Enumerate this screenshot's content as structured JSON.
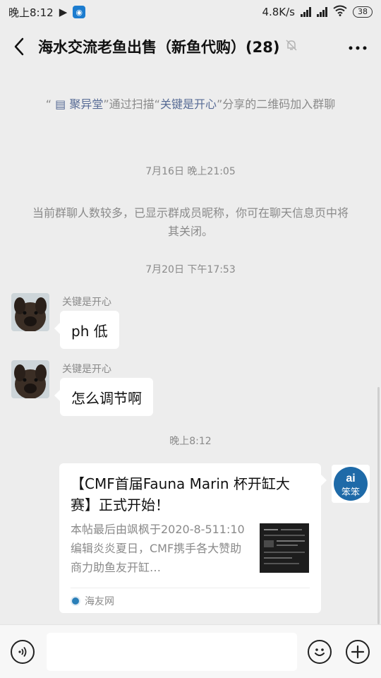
{
  "status_bar": {
    "time": "晚上8:12",
    "network_speed": "4.8K/s",
    "battery": "38"
  },
  "header": {
    "title": "海水交流老鱼出售（新鱼代购）(28)"
  },
  "system_notes": {
    "join": {
      "p1": "“ ",
      "member": "聚异堂",
      "p2": "”通过扫描“",
      "inviter": "关键是开心",
      "p3": "”分享的二维码加入群聊"
    },
    "nickname_note": "当前群聊人数较多，已显示群成员昵称，你可在聊天信息页中将其关闭。"
  },
  "timestamps": [
    "7月16日 晚上21:05",
    "7月20日 下午17:53",
    "晚上8:12"
  ],
  "messages": [
    {
      "sender": "关键是开心",
      "text": "ph 低"
    },
    {
      "sender": "关键是开心",
      "text": "怎么调节啊"
    }
  ],
  "link_card": {
    "title": "【CMF首届Fauna Marin 杯开缸大赛】正式开始！",
    "body": "本帖最后由飒枫于2020-8-511:10编辑炎炎夏日，CMF携手各大赞助商力助鱼友开缸…",
    "source": "海友网"
  },
  "colors": {
    "link_blue": "#576b95",
    "background": "#ededed",
    "bubble_white": "#ffffff",
    "muted_text": "#8a8a8a"
  },
  "icons": [
    "back-arrow-icon",
    "mute-bell-icon",
    "more-icon",
    "voice-icon",
    "emoji-icon",
    "plus-icon"
  ]
}
